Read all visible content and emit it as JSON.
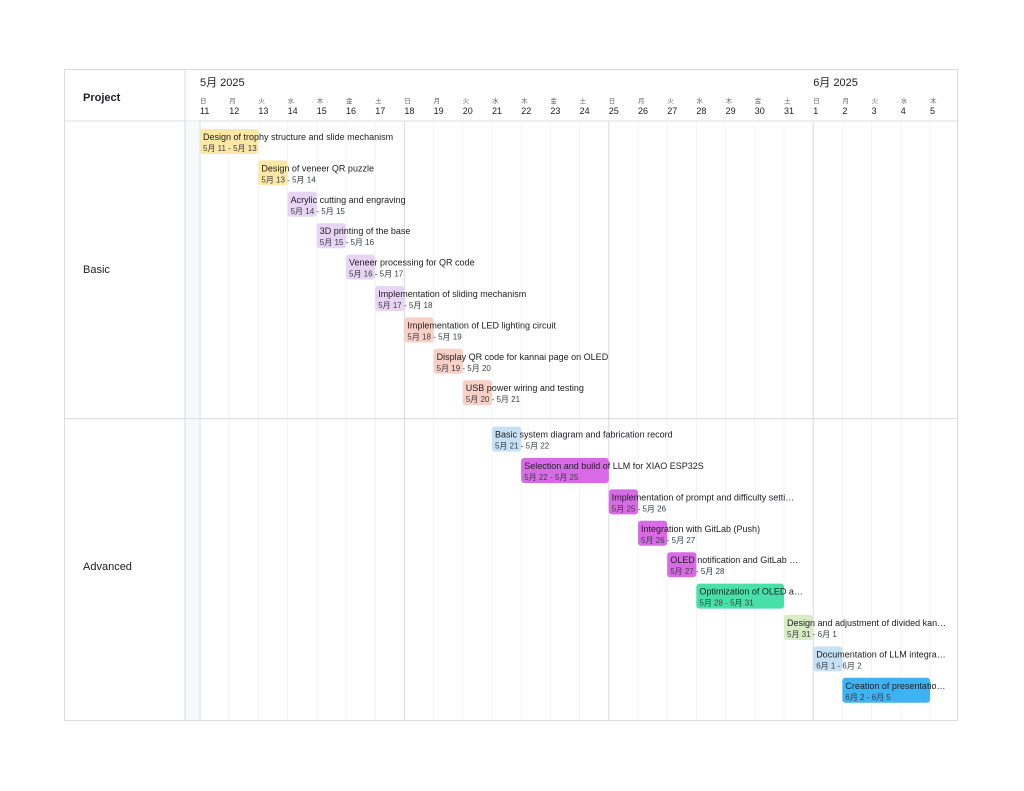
{
  "header": {
    "project_label": "Project"
  },
  "groups": [
    {
      "label": "Basic",
      "task_indices": [
        0,
        1,
        2,
        3,
        4,
        5,
        6,
        7,
        8
      ]
    },
    {
      "label": "Advanced",
      "task_indices": [
        9,
        10,
        11,
        12,
        13,
        14,
        15,
        16,
        17
      ]
    }
  ],
  "months": [
    {
      "label": "5月 2025",
      "start_day": "2025-05-11"
    },
    {
      "label": "6月 2025",
      "start_day": "2025-06-01"
    }
  ],
  "days": [
    {
      "dow": "日",
      "num": "11"
    },
    {
      "dow": "月",
      "num": "12"
    },
    {
      "dow": "火",
      "num": "13"
    },
    {
      "dow": "水",
      "num": "14"
    },
    {
      "dow": "木",
      "num": "15"
    },
    {
      "dow": "金",
      "num": "16"
    },
    {
      "dow": "土",
      "num": "17"
    },
    {
      "dow": "日",
      "num": "18"
    },
    {
      "dow": "月",
      "num": "19"
    },
    {
      "dow": "火",
      "num": "20"
    },
    {
      "dow": "水",
      "num": "21"
    },
    {
      "dow": "木",
      "num": "22"
    },
    {
      "dow": "金",
      "num": "23"
    },
    {
      "dow": "土",
      "num": "24"
    },
    {
      "dow": "日",
      "num": "25"
    },
    {
      "dow": "月",
      "num": "26"
    },
    {
      "dow": "火",
      "num": "27"
    },
    {
      "dow": "水",
      "num": "28"
    },
    {
      "dow": "木",
      "num": "29"
    },
    {
      "dow": "金",
      "num": "30"
    },
    {
      "dow": "土",
      "num": "31"
    },
    {
      "dow": "日",
      "num": "1"
    },
    {
      "dow": "月",
      "num": "2"
    },
    {
      "dow": "火",
      "num": "3"
    },
    {
      "dow": "水",
      "num": "4"
    },
    {
      "dow": "木",
      "num": "5"
    }
  ],
  "chart_data": {
    "type": "gantt",
    "x_start": "2025-05-11",
    "x_end": "2025-06-05",
    "tasks": [
      {
        "name": "Design of trophy structure and slide mechanism",
        "range": "5月 11 - 5月 13",
        "start": "2025-05-11",
        "end": "2025-05-13",
        "color": "#fce8a6",
        "group": "Basic"
      },
      {
        "name": "Design of veneer QR puzzle",
        "range": "5月 13 - 5月 14",
        "start": "2025-05-13",
        "end": "2025-05-14",
        "color": "#fce8a6",
        "group": "Basic"
      },
      {
        "name": "Acrylic cutting and engraving",
        "range": "5月 14 - 5月 15",
        "start": "2025-05-14",
        "end": "2025-05-15",
        "color": "#e8d5f5",
        "group": "Basic"
      },
      {
        "name": "3D printing of the base",
        "range": "5月 15 - 5月 16",
        "start": "2025-05-15",
        "end": "2025-05-16",
        "color": "#e8d5f5",
        "group": "Basic"
      },
      {
        "name": "Veneer processing for QR code",
        "range": "5月 16 - 5月 17",
        "start": "2025-05-16",
        "end": "2025-05-17",
        "color": "#e8d5f5",
        "group": "Basic"
      },
      {
        "name": "Implementation of sliding mechanism",
        "range": "5月 17 - 5月 18",
        "start": "2025-05-17",
        "end": "2025-05-18",
        "color": "#e8d5f5",
        "group": "Basic"
      },
      {
        "name": "Implementation of LED lighting circuit",
        "range": "5月 18 - 5月 19",
        "start": "2025-05-18",
        "end": "2025-05-19",
        "color": "#f9cfc6",
        "group": "Basic"
      },
      {
        "name": "Display QR code for kannai page on OLED",
        "range": "5月 19 - 5月 20",
        "start": "2025-05-19",
        "end": "2025-05-20",
        "color": "#f9cfc6",
        "group": "Basic"
      },
      {
        "name": "USB power wiring and testing",
        "range": "5月 20 - 5月 21",
        "start": "2025-05-20",
        "end": "2025-05-21",
        "color": "#f9cfc6",
        "group": "Basic"
      },
      {
        "name": "Basic system diagram and fabrication record",
        "range": "5月 21 - 5月 22",
        "start": "2025-05-21",
        "end": "2025-05-22",
        "color": "#c6e1f5",
        "group": "Advanced"
      },
      {
        "name": "Selection and build of LLM for XIAO ESP32S",
        "range": "5月 22 - 5月 25",
        "start": "2025-05-22",
        "end": "2025-05-25",
        "color": "#d86ae6",
        "group": "Advanced"
      },
      {
        "name": "Implementation of prompt and difficulty setti…",
        "range": "5月 25 - 5月 26",
        "start": "2025-05-25",
        "end": "2025-05-26",
        "color": "#d86ae6",
        "group": "Advanced"
      },
      {
        "name": "Integration with GitLab (Push)",
        "range": "5月 26 - 5月 27",
        "start": "2025-05-26",
        "end": "2025-05-27",
        "color": "#d86ae6",
        "group": "Advanced"
      },
      {
        "name": "OLED notification and GitLab …",
        "range": "5月 27 - 5月 28",
        "start": "2025-05-27",
        "end": "2025-05-28",
        "color": "#d86ae6",
        "group": "Advanced"
      },
      {
        "name": "Optimization of OLED a…",
        "range": "5月 28 - 5月 31",
        "start": "2025-05-28",
        "end": "2025-05-31",
        "color": "#47e0a8",
        "group": "Advanced"
      },
      {
        "name": "Design and adjustment of divided kan…",
        "range": "5月 31 - 6月 1",
        "start": "2025-05-31",
        "end": "2025-06-01",
        "color": "#d8edc4",
        "group": "Advanced"
      },
      {
        "name": "Documentation of LLM integra…",
        "range": "6月 1 - 6月 2",
        "start": "2025-06-01",
        "end": "2025-06-02",
        "color": "#c6e1f5",
        "group": "Advanced"
      },
      {
        "name": "Creation of presentatio…",
        "range": "6月 2 - 6月 5",
        "start": "2025-06-02",
        "end": "2025-06-05",
        "color": "#3fb3f2",
        "group": "Advanced"
      }
    ]
  }
}
